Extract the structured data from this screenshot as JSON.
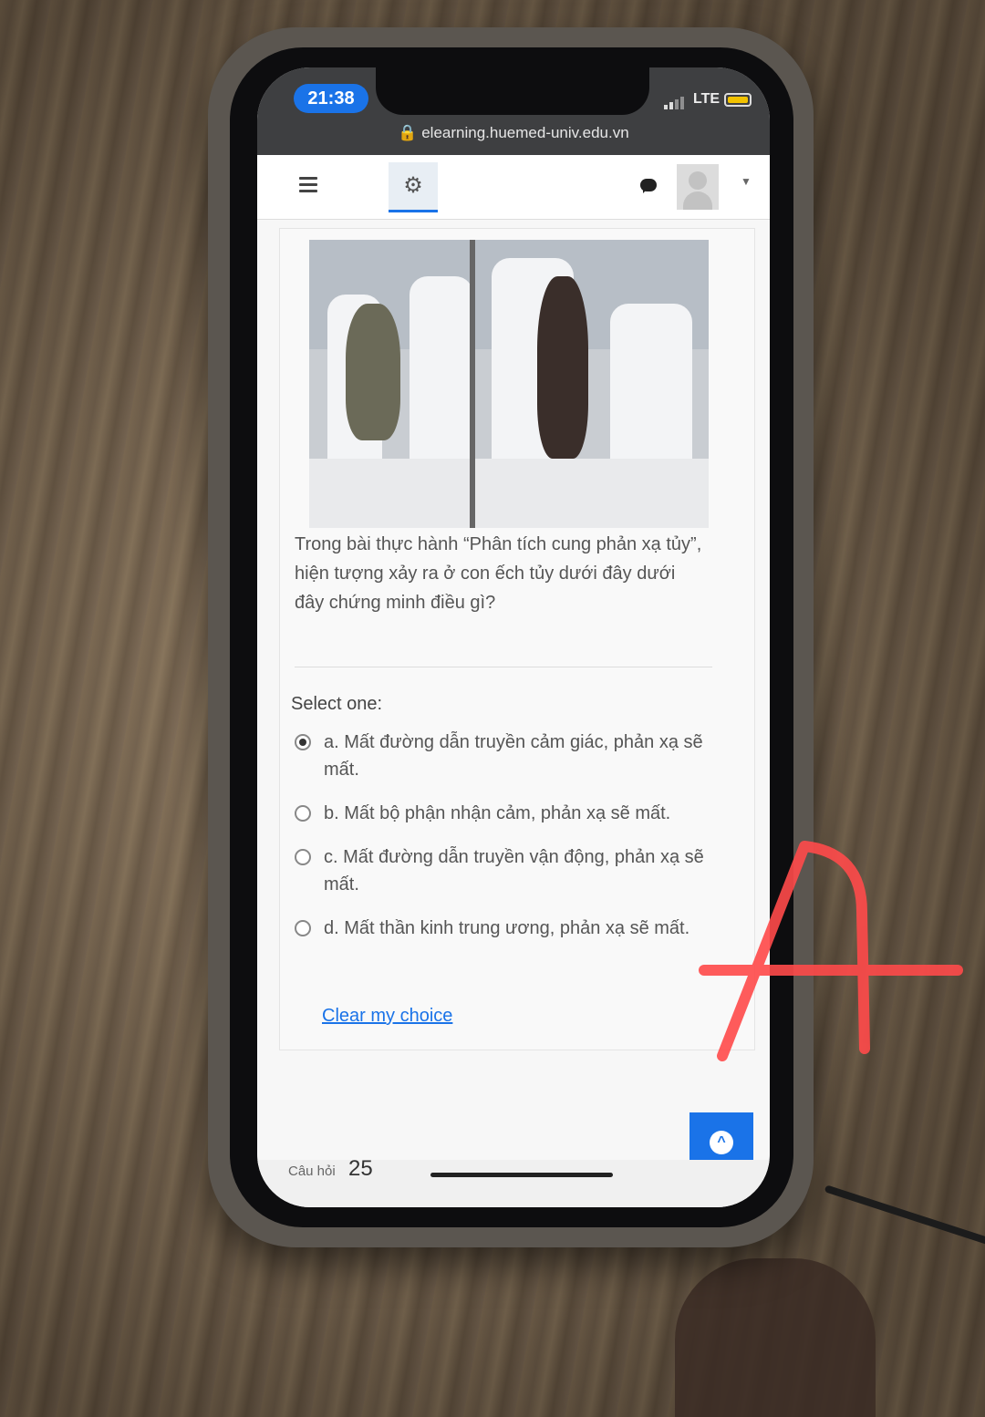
{
  "status": {
    "time": "21:38",
    "network": "LTE"
  },
  "browser": {
    "url": "elearning.huemed-univ.edu.vn"
  },
  "question": {
    "text": "Trong bài thực hành “Phân tích cung phản xạ tủy”, hiện tượng xảy ra ở con ếch tủy dưới đây dưới đây chứng minh điều gì?",
    "select_label": "Select one:",
    "options": [
      {
        "label": "a. Mất đường dẫn truyền cảm giác, phản xạ sẽ mất.",
        "selected": true
      },
      {
        "label": "b. Mất bộ phận nhận cảm, phản xạ sẽ mất.",
        "selected": false
      },
      {
        "label": "c. Mất đường dẫn truyền vận động, phản xạ sẽ mất.",
        "selected": false
      },
      {
        "label": "d. Mất thần kinh trung ương, phản xạ sẽ mất.",
        "selected": false
      }
    ],
    "clear_label": "Clear my choice"
  },
  "footer": {
    "question_label": "Câu hỏi",
    "question_number": "25"
  },
  "annotation": {
    "letter": "A",
    "color": "#ff4a4a"
  },
  "icons": {
    "menu": "hamburger-icon",
    "settings": "gear-icon",
    "messages": "chat-bubble-icon",
    "scroll": "chevron-up-icon"
  },
  "colors": {
    "accent": "#1a73e8",
    "navbar": "#ffffff",
    "statusbar": "#3e3f41"
  }
}
